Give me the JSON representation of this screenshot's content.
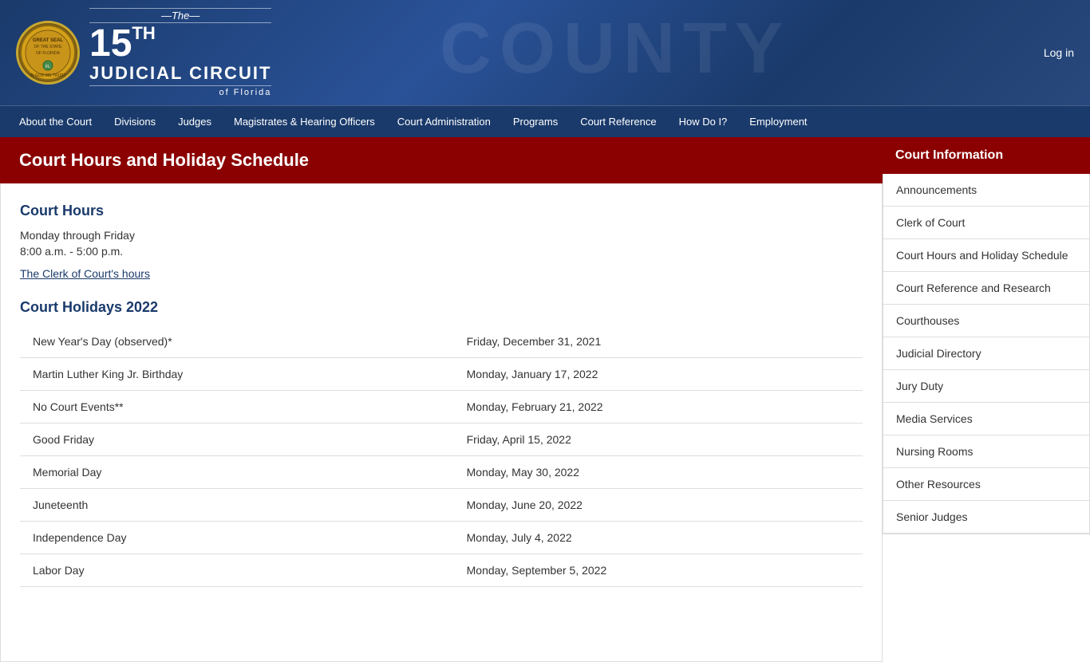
{
  "header": {
    "the_label": "—The—",
    "circuit_number": "15",
    "circuit_sup": "TH",
    "circuit_name": "Judicial Circuit",
    "of_florida": "of Florida",
    "bg_text": "COUNTY",
    "login_label": "Log in"
  },
  "nav": {
    "items": [
      {
        "label": "About the Court",
        "href": "#"
      },
      {
        "label": "Divisions",
        "href": "#"
      },
      {
        "label": "Judges",
        "href": "#"
      },
      {
        "label": "Magistrates & Hearing Officers",
        "href": "#"
      },
      {
        "label": "Court Administration",
        "href": "#"
      },
      {
        "label": "Programs",
        "href": "#"
      },
      {
        "label": "Court Reference",
        "href": "#"
      },
      {
        "label": "How Do I?",
        "href": "#"
      },
      {
        "label": "Employment",
        "href": "#"
      }
    ]
  },
  "page": {
    "title": "Court Hours and Holiday Schedule"
  },
  "court_hours": {
    "section_title": "Court Hours",
    "hours_line1": "Monday through Friday",
    "hours_line2": "8:00 a.m. - 5:00 p.m.",
    "clerk_link_text": "The Clerk of Court's hours"
  },
  "holidays": {
    "section_title": "Court Holidays 2022",
    "rows": [
      {
        "holiday": "New Year's Day (observed)*",
        "date": "Friday, December 31, 2021"
      },
      {
        "holiday": "Martin Luther King Jr. Birthday",
        "date": "Monday, January 17, 2022"
      },
      {
        "holiday": "No Court Events**",
        "date": "Monday, February 21, 2022"
      },
      {
        "holiday": "Good Friday",
        "date": "Friday, April 15, 2022"
      },
      {
        "holiday": "Memorial Day",
        "date": "Monday, May 30, 2022"
      },
      {
        "holiday": "Juneteenth",
        "date": "Monday, June 20, 2022"
      },
      {
        "holiday": "Independence Day",
        "date": "Monday, July 4, 2022"
      },
      {
        "holiday": "Labor Day",
        "date": "Monday, September 5, 2022"
      }
    ]
  },
  "sidebar": {
    "header": "Court Information",
    "items": [
      {
        "label": "Announcements",
        "active": false
      },
      {
        "label": "Clerk of Court",
        "active": false
      },
      {
        "label": "Court Hours and Holiday Schedule",
        "active": true
      },
      {
        "label": "Court Reference and Research",
        "active": false
      },
      {
        "label": "Courthouses",
        "active": false
      },
      {
        "label": "Judicial Directory",
        "active": false
      },
      {
        "label": "Jury Duty",
        "active": false
      },
      {
        "label": "Media Services",
        "active": false
      },
      {
        "label": "Nursing Rooms",
        "active": false
      },
      {
        "label": "Other Resources",
        "active": false
      },
      {
        "label": "Senior Judges",
        "active": false
      }
    ]
  }
}
